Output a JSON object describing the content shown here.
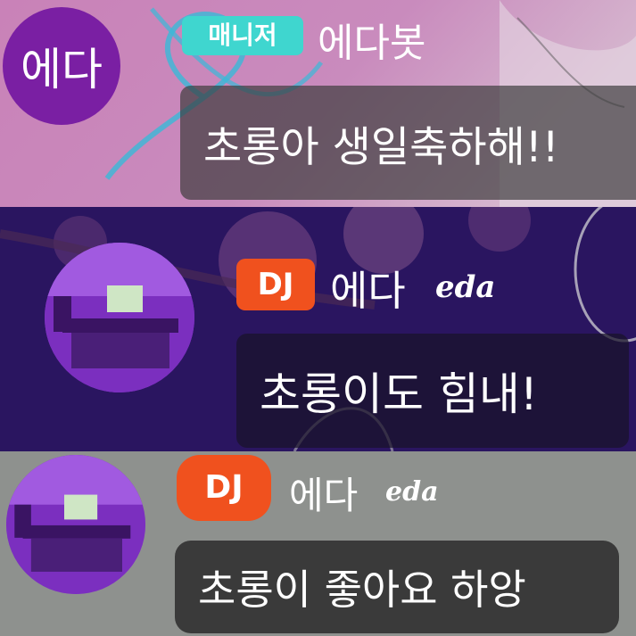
{
  "messages": [
    {
      "avatar_text": "에다",
      "badge": "매니저",
      "name": "에다봇",
      "name_suffix": "",
      "text": "초롱아 생일축하해!!"
    },
    {
      "avatar_text": "",
      "badge": "DJ",
      "name": "에다",
      "name_suffix": "eda",
      "text": "초롱이도 힘내!"
    },
    {
      "avatar_text": "",
      "badge": "DJ",
      "name": "에다",
      "name_suffix": "eda",
      "text": "초롱이 좋아요 하앙"
    }
  ],
  "colors": {
    "manager_badge": "#3fd6cf",
    "dj_badge": "#f0511e",
    "bot_avatar": "#7a1fa3",
    "bubble": "#3a3a3a"
  }
}
